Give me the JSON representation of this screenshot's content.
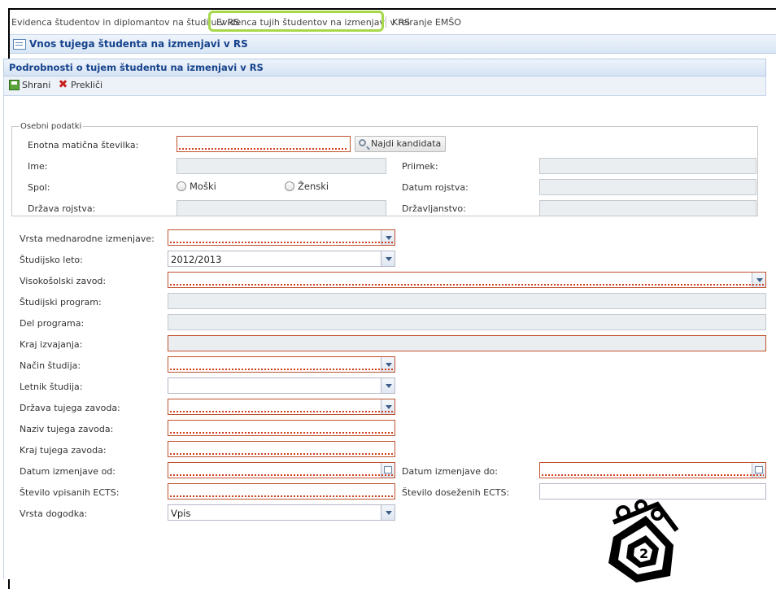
{
  "tabs": [
    {
      "label": "Evidenca študentov in diplomantov na študiju v RS"
    },
    {
      "label": "Evidenca tujih študentov na izmenjavi v RS"
    },
    {
      "label": "Kreiranje EMŠO"
    }
  ],
  "header": {
    "title": "Vnos tujega študenta na izmenjavi v RS"
  },
  "panel": {
    "title": "Podrobnosti o tujem študentu na izmenjavi v RS"
  },
  "toolbar": {
    "save_label": "Shrani",
    "cancel_label": "Prekliči"
  },
  "personal": {
    "legend": "Osebni podatki",
    "emso_label": "Enotna matična številka:",
    "find_button": "Najdi kandidata",
    "ime_label": "Ime:",
    "priimek_label": "Priimek:",
    "spol_label": "Spol:",
    "spol_m": "Moški",
    "spol_z": "Ženski",
    "datum_rojstva_label": "Datum rojstva:",
    "drzava_rojstva_label": "Država rojstva:",
    "drzavljanstvo_label": "Državljanstvo:"
  },
  "form": {
    "vrsta_label": "Vrsta mednarodne izmenjave:",
    "leto_label": "Študijsko leto:",
    "leto_value": "2012/2013",
    "zavod_label": "Visokošolski zavod:",
    "program_label": "Študijski program:",
    "del_label": "Del programa:",
    "kraj_label": "Kraj izvajanja:",
    "nacin_label": "Način študija:",
    "letnik_label": "Letnik študija:",
    "drzava_tz_label": "Država tujega zavoda:",
    "naziv_tz_label": "Naziv tujega zavoda:",
    "kraj_tz_label": "Kraj tujega zavoda:",
    "datum_od_label": "Datum izmenjave od:",
    "datum_do_label": "Datum izmenjave do:",
    "ects_vpis_label": "Število vpisanih ECTS:",
    "ects_dos_label": "Število doseženih ECTS:",
    "dogodek_label": "Vrsta dogodka:",
    "dogodek_value": "Vpis"
  },
  "colors": {
    "accent": "#15428b",
    "active_tab_ring": "#a6d84b",
    "required_border": "#c0522e"
  }
}
